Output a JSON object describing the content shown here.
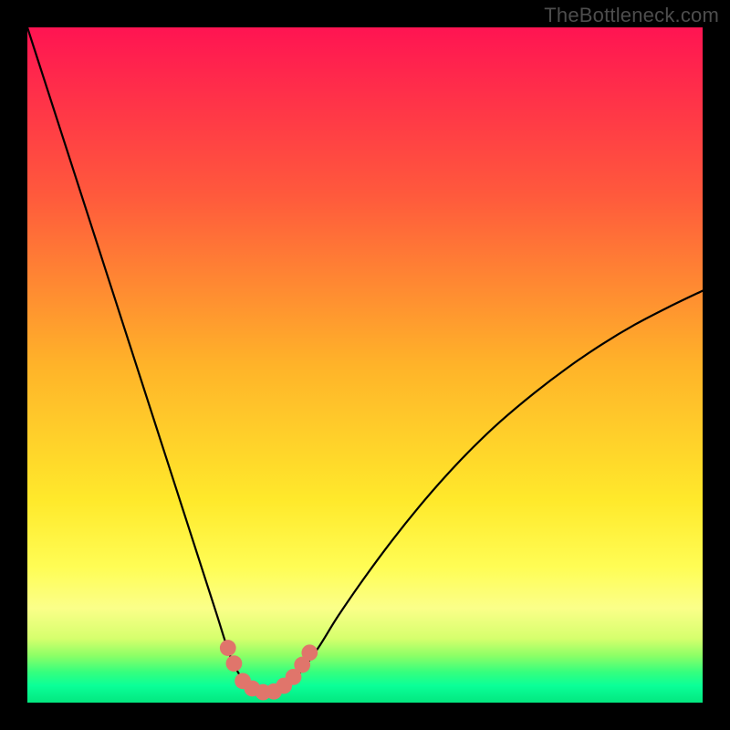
{
  "watermark": "TheBottleneck.com",
  "chart_data": {
    "type": "line",
    "title": "",
    "xlabel": "",
    "ylabel": "",
    "xlim": [
      0,
      100
    ],
    "ylim": [
      0,
      100
    ],
    "gradient_stops": [
      {
        "offset": 0.0,
        "color": "#ff1452"
      },
      {
        "offset": 0.25,
        "color": "#ff5a3c"
      },
      {
        "offset": 0.5,
        "color": "#ffb329"
      },
      {
        "offset": 0.7,
        "color": "#ffe92b"
      },
      {
        "offset": 0.8,
        "color": "#fffd55"
      },
      {
        "offset": 0.86,
        "color": "#fbff89"
      },
      {
        "offset": 0.905,
        "color": "#d6ff6d"
      },
      {
        "offset": 0.93,
        "color": "#8eff66"
      },
      {
        "offset": 0.955,
        "color": "#35ff7e"
      },
      {
        "offset": 0.975,
        "color": "#0aff98"
      },
      {
        "offset": 1.0,
        "color": "#03e77f"
      }
    ],
    "series": [
      {
        "name": "bottleneck-curve",
        "x": [
          0.0,
          2.0,
          4.0,
          6.0,
          8.0,
          10.0,
          12.0,
          14.0,
          16.0,
          18.0,
          20.0,
          22.0,
          24.0,
          26.0,
          28.0,
          30.0,
          31.5,
          33.0,
          34.5,
          36.0,
          38.0,
          40.0,
          43.0,
          46.0,
          50.0,
          54.0,
          58.0,
          62.0,
          66.0,
          70.0,
          75.0,
          80.0,
          85.0,
          90.0,
          95.0,
          100.0
        ],
        "y": [
          100.0,
          93.8,
          87.6,
          81.4,
          75.2,
          69.0,
          62.8,
          56.6,
          50.4,
          44.2,
          38.0,
          31.8,
          25.6,
          19.4,
          13.2,
          7.0,
          4.0,
          2.2,
          1.4,
          1.4,
          2.2,
          4.0,
          8.0,
          12.8,
          18.6,
          24.0,
          29.0,
          33.6,
          37.8,
          41.6,
          45.8,
          49.6,
          53.0,
          56.0,
          58.6,
          61.0
        ]
      }
    ],
    "markers": {
      "name": "highlight-points",
      "color": "#e0756b",
      "radius_pct": 1.2,
      "points": [
        {
          "x": 29.7,
          "y": 8.1
        },
        {
          "x": 30.6,
          "y": 5.8
        },
        {
          "x": 31.9,
          "y": 3.2
        },
        {
          "x": 33.3,
          "y": 2.1
        },
        {
          "x": 34.9,
          "y": 1.55
        },
        {
          "x": 36.5,
          "y": 1.65
        },
        {
          "x": 38.0,
          "y": 2.5
        },
        {
          "x": 39.4,
          "y": 3.8
        },
        {
          "x": 40.7,
          "y": 5.6
        },
        {
          "x": 41.8,
          "y": 7.4
        }
      ]
    }
  }
}
